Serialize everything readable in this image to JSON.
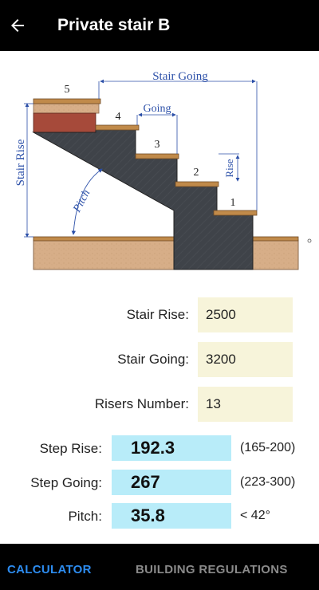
{
  "app_bar": {
    "title": "Private stair B",
    "back_icon": "arrow-left-icon"
  },
  "diagram": {
    "labels": {
      "stair_going": "Stair Going",
      "going": "Going",
      "stair_rise": "Stair Rise",
      "rise": "Rise",
      "pitch": "Pitch",
      "step_numbers": [
        "1",
        "2",
        "3",
        "4",
        "5"
      ]
    },
    "colors": {
      "line": "#2b4fa8",
      "concrete": "#3d4147",
      "wood": "#d7ae88",
      "tread": "#c08a4a",
      "brick": "#a64a3a"
    }
  },
  "inputs": [
    {
      "label": "Stair Rise:",
      "value": "2500"
    },
    {
      "label": "Stair Going:",
      "value": "3200"
    },
    {
      "label": "Risers Number:",
      "value": "13"
    }
  ],
  "results": [
    {
      "label": "Step Rise:",
      "value": "192.3",
      "range": "(165-200)"
    },
    {
      "label": "Step Going:",
      "value": "267",
      "range": "(223-300)"
    },
    {
      "label": "Pitch:",
      "value": "35.8",
      "range": "< 42°"
    }
  ],
  "bottom_nav": {
    "tabs": [
      {
        "label": "CALCULATOR",
        "active": true
      },
      {
        "label": "BUILDING REGULATIONS",
        "active": false
      }
    ],
    "active_color": "#2d8cf0",
    "inactive_color": "#8a8a8a"
  }
}
